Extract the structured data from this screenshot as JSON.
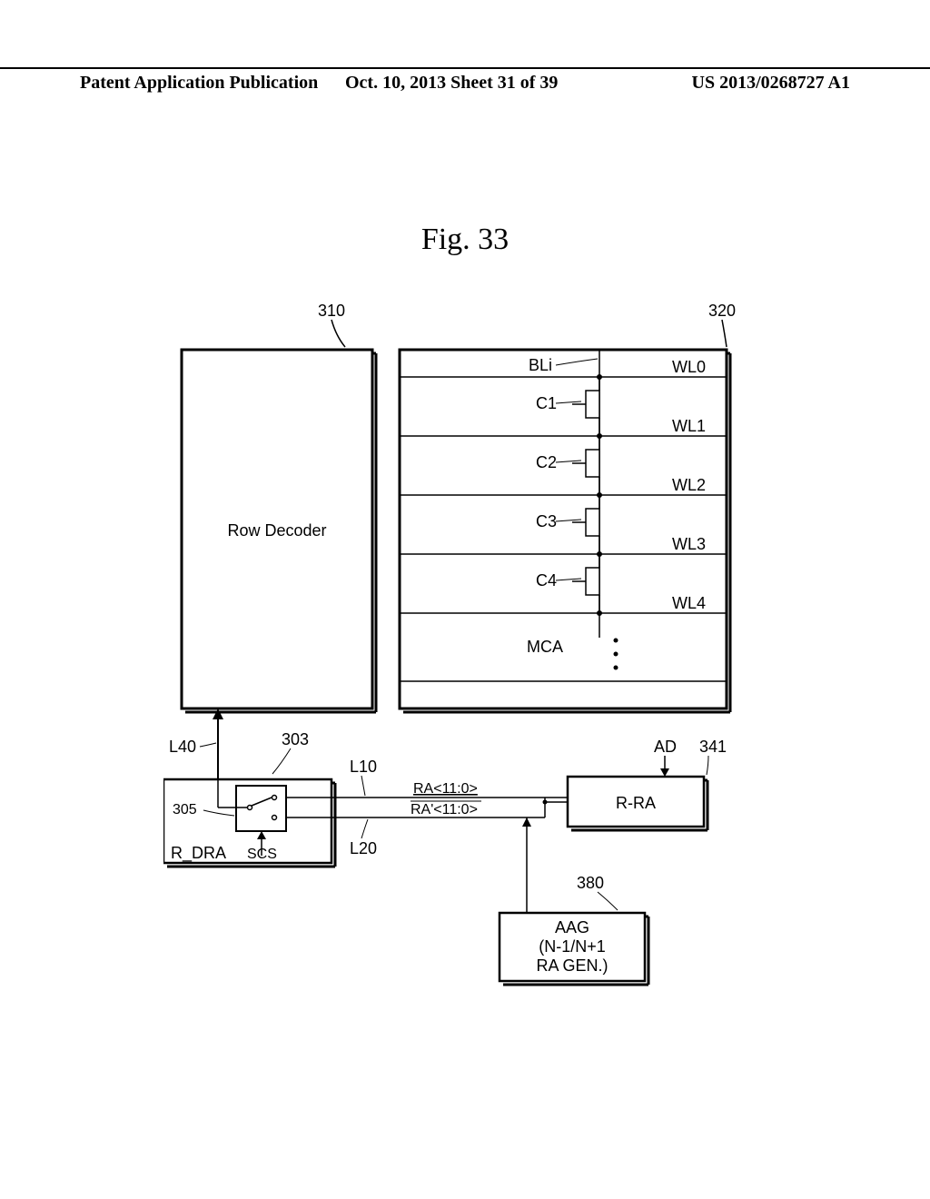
{
  "header": {
    "left": "Patent Application Publication",
    "mid": "Oct. 10, 2013  Sheet 31 of 39",
    "right": "US 2013/0268727 A1"
  },
  "figure": {
    "title": "Fig. 33"
  },
  "labels": {
    "ref310": "310",
    "ref320": "320",
    "rowdecoder": "Row Decoder",
    "BLi": "BLi",
    "C1": "C1",
    "C2": "C2",
    "C3": "C3",
    "C4": "C4",
    "WL0": "WL0",
    "WL1": "WL1",
    "WL2": "WL2",
    "WL3": "WL3",
    "WL4": "WL4",
    "MCA": "MCA",
    "L40": "L40",
    "ref303": "303",
    "L10": "L10",
    "L20": "L20",
    "RA": "RA<11:0>",
    "RAprime": "RA'<11:0>",
    "RRA": "R-RA",
    "AD": "AD",
    "ref341": "341",
    "ref305": "305",
    "RDRA": "R_DRA",
    "SCS": "SCS",
    "ref380": "380",
    "AAG1": "AAG",
    "AAG2": "(N-1/N+1",
    "AAG3": "RA GEN.)"
  }
}
